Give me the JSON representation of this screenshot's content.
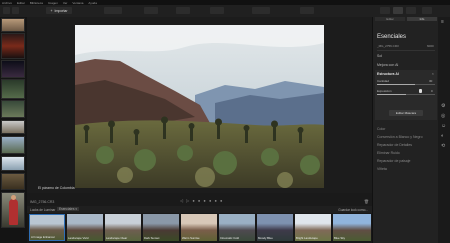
{
  "menubar": {
    "items": [
      "Archivo",
      "Editar",
      "Biblioteca",
      "Imagen",
      "Ver",
      "Ventana",
      "Ayuda"
    ]
  },
  "toolbar": {
    "import_label": "Importar"
  },
  "photo": {
    "caption": "El páramo de Colombia"
  },
  "info_bar": {
    "filename": "IMG_2756.CR3",
    "nav": "◁ ▷ ● ● ● ● ● ●"
  },
  "filmstrip_bar": {
    "left_label": "Looks de Luminar",
    "dropdown": "Esenciales",
    "right_label": "Guardar look como..."
  },
  "filmstrip": {
    "items": [
      "AI Image Enhancer",
      "Landscape Vivid",
      "Landscape Clear",
      "Dark Sunset",
      "Warm Sunrise",
      "Cinematic Cold",
      "Moody Blue",
      "Bright Landscape",
      "Blue Sky",
      "Rich Colors"
    ]
  },
  "right_panel": {
    "tabs": [
      "Editar",
      "Info"
    ],
    "title": "Esenciales",
    "file": "_MG_2756.CR3",
    "file_size": "6000",
    "sol_label": "Sol",
    "ai_label": "Mejora con AI",
    "section_title": "Estructura AI",
    "sliders": [
      {
        "label": "Cantidad",
        "value": "30",
        "fill": 0.65
      },
      {
        "label": "Exposición",
        "value": "0",
        "fill": 0.5
      }
    ],
    "mask_button": "Editar Máscara",
    "sections": [
      "Color",
      "Conversión a Blanco y Negro",
      "Reparador de Detalles",
      "Eliminar Ruido",
      "Reparador de paisaje",
      "Viñeta"
    ]
  },
  "colors": {
    "accent": "#2f6fb5",
    "panel": "#222222",
    "bg": "#1a1a1a"
  }
}
